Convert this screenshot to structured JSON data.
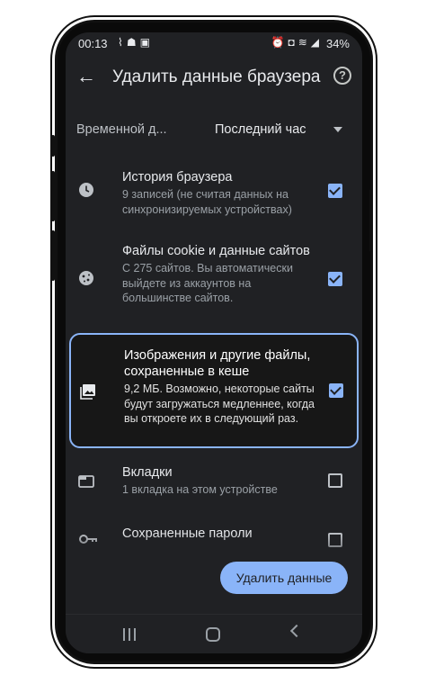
{
  "status_bar": {
    "time": "00:13",
    "left_icons": [
      "notification-icon",
      "android-icon",
      "image-icon"
    ],
    "right_icons": [
      "alarm-icon",
      "battery-saver-icon",
      "wifi-icon",
      "signal-icon"
    ],
    "battery": "34%"
  },
  "app_bar": {
    "title": "Удалить данные браузера",
    "back_icon": "arrow-back-icon",
    "help_icon": "help-icon",
    "help_glyph": "?"
  },
  "time_range": {
    "label": "Временной д...",
    "value": "Последний час"
  },
  "items": [
    {
      "title": "История браузера",
      "subtitle": "9 записей (не считая данных на синхронизируемых устройствах)",
      "icon": "clock-icon",
      "checked": true
    },
    {
      "title": "Файлы cookie и данные сайтов",
      "subtitle": "С 275 сайтов. Вы автоматически выйдете из аккаунтов на большинстве сайтов.",
      "icon": "cookie-icon",
      "checked": true
    },
    {
      "title": "Изображения и другие файлы, сохраненные в кеше",
      "subtitle": "9,2 МБ. Возможно, некоторые сайты будут загружаться медленнее, когда вы откроете их в следующий раз.",
      "icon": "image-icon",
      "checked": true,
      "highlighted": true
    },
    {
      "title": "Вкладки",
      "subtitle": "1 вкладка на этом устройстве",
      "icon": "tab-icon",
      "checked": false
    },
    {
      "title": "Сохраненные пароли",
      "subtitle": "",
      "icon": "key-icon",
      "checked": false
    }
  ],
  "clear_button": {
    "label": "Удалить данные"
  },
  "nav_bar": {
    "items": [
      "recents-icon",
      "home-icon",
      "back-icon"
    ]
  },
  "colors": {
    "background": "#202124",
    "accent": "#8ab4f8",
    "text_primary": "#e8eaed",
    "text_secondary": "#9aa0a6"
  }
}
